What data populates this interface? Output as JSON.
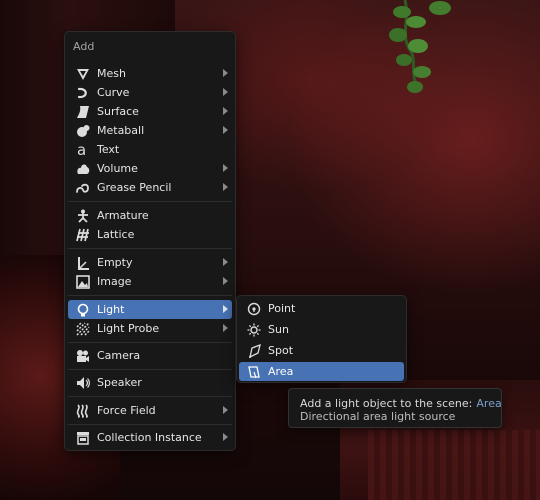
{
  "menu": {
    "title": "Add",
    "items": [
      {
        "label": "Mesh",
        "icon": "mesh-icon",
        "submenu": true
      },
      {
        "label": "Curve",
        "icon": "curve-icon",
        "submenu": true
      },
      {
        "label": "Surface",
        "icon": "surface-icon",
        "submenu": true
      },
      {
        "label": "Metaball",
        "icon": "metaball-icon",
        "submenu": true
      },
      {
        "label": "Text",
        "icon": "text-icon",
        "submenu": false
      },
      {
        "label": "Volume",
        "icon": "volume-icon",
        "submenu": true
      },
      {
        "label": "Grease Pencil",
        "icon": "grease-pencil-icon",
        "submenu": true
      },
      {
        "label": "Armature",
        "icon": "armature-icon",
        "submenu": false
      },
      {
        "label": "Lattice",
        "icon": "lattice-icon",
        "submenu": false
      },
      {
        "label": "Empty",
        "icon": "empty-icon",
        "submenu": true
      },
      {
        "label": "Image",
        "icon": "image-icon",
        "submenu": true
      },
      {
        "label": "Light",
        "icon": "light-icon",
        "submenu": true,
        "active": true
      },
      {
        "label": "Light Probe",
        "icon": "light-probe-icon",
        "submenu": true
      },
      {
        "label": "Camera",
        "icon": "camera-icon",
        "submenu": false
      },
      {
        "label": "Speaker",
        "icon": "speaker-icon",
        "submenu": false
      },
      {
        "label": "Force Field",
        "icon": "force-field-icon",
        "submenu": true
      },
      {
        "label": "Collection Instance",
        "icon": "collection-icon",
        "submenu": true
      }
    ]
  },
  "light_submenu": {
    "items": [
      {
        "label": "Point",
        "icon": "point-light-icon"
      },
      {
        "label": "Sun",
        "icon": "sun-light-icon"
      },
      {
        "label": "Spot",
        "icon": "spot-light-icon"
      },
      {
        "label": "Area",
        "icon": "area-light-icon",
        "active": true
      }
    ]
  },
  "tooltip": {
    "description": "Add a light object to the scene:",
    "python": "Area",
    "detail": "Directional area light source"
  },
  "colors": {
    "menu_bg": "#181818",
    "highlight": "#4772b3",
    "text": "#e6e6e6",
    "tooltip_python": "#7f9fcf"
  }
}
